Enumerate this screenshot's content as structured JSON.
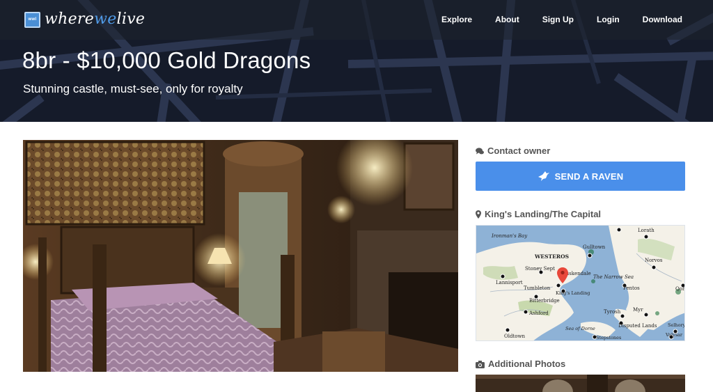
{
  "brand": {
    "prefix": "where",
    "accent": "we",
    "suffix": "live",
    "badge": "wwl",
    "accent_color": "#4f9be8"
  },
  "nav": {
    "items": [
      "Explore",
      "About",
      "Sign Up",
      "Login",
      "Download"
    ]
  },
  "listing": {
    "title": "8br - $10,000 Gold Dragons",
    "subtitle": "Stunning castle, must-see, only for royalty"
  },
  "sidebar": {
    "contact_heading": "Contact owner",
    "contact_icon": "chat-bubbles-icon",
    "raven_button": "SEND A RAVEN",
    "raven_icon": "bird-icon",
    "button_color": "#4a8fea",
    "location_heading": "King's Landing/The Capital",
    "location_icon": "map-pin-icon",
    "photos_heading": "Additional Photos",
    "photos_icon": "camera-icon"
  },
  "map": {
    "places": [
      "Ironman's Bay",
      "WESTEROS",
      "Lorath",
      "Gulltown",
      "Norvos",
      "Stoney Sept",
      "Duskendale",
      "Lannisport",
      "The Narrow Sea",
      "Pentos",
      "Qohor",
      "Tumbleton",
      "King's Landing",
      "Bitterbridge",
      "Tyrosh",
      "Myr",
      "Ashford",
      "Sea of Dorne",
      "Disputed Lands",
      "Selhorys",
      "Oldtown",
      "Stepstones",
      "Valysar"
    ],
    "pin_color": "#e8483a"
  }
}
